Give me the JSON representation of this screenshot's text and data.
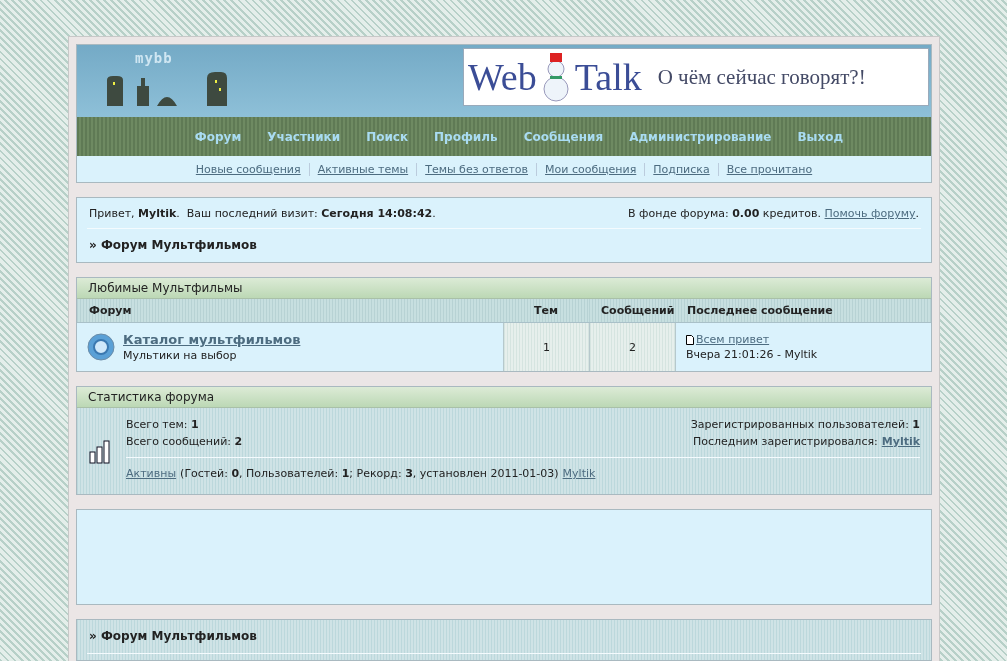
{
  "header": {
    "logo": "mybb",
    "banner": {
      "brand_left": "Web",
      "brand_right": "Talk",
      "slogan": "О чём сейчас говорят?!"
    }
  },
  "nav": [
    {
      "label": "Форум"
    },
    {
      "label": "Участники"
    },
    {
      "label": "Поиск"
    },
    {
      "label": "Профиль"
    },
    {
      "label": "Сообщения"
    },
    {
      "label": "Администрирование"
    },
    {
      "label": "Выход"
    }
  ],
  "sublinks": [
    "Новые сообщения",
    "Активные темы",
    "Темы без ответов",
    "Мои сообщения",
    "Подписка",
    "Все прочитано"
  ],
  "welcome": {
    "text": "Привет, **Myltik**.  Ваш последний визит: **Сегодня 14:08:42**.",
    "fund": "В фонде форума: **0.00** кредитов.",
    "fund_link": "Помочь форуму",
    "fund_end": ".",
    "breadcrumb": "» Форум Мультфильмов"
  },
  "category": {
    "title": "Любимые Мультфильмы",
    "columns": [
      "Форум",
      "Тем",
      "Сообщений",
      "Последнее сообщение"
    ],
    "rows": [
      {
        "name": "Каталог мультфильмов",
        "description": "Мультики на выбор",
        "topics": "1",
        "posts": "2",
        "last_post": "Всем привет",
        "last_info": "Вчера 21:01:26 - Myltik"
      }
    ]
  },
  "stats": {
    "title": "Статистика форума",
    "left": [
      "Всего тем: **1**",
      "Всего сообщений: **2**"
    ],
    "registered": "Зарегистрированных пользователей: **1**",
    "last_label": "Последним зарегистрировался:",
    "last_user": "Myltik",
    "active_link": "Активны",
    "active_text": "(Гостей: **0**, Пользователей: **1**; Рекорд: **3**, установлен 2011-01-03)",
    "active_user": "Myltik"
  },
  "footer": {
    "breadcrumb": "» Форум Мультфильмов"
  }
}
